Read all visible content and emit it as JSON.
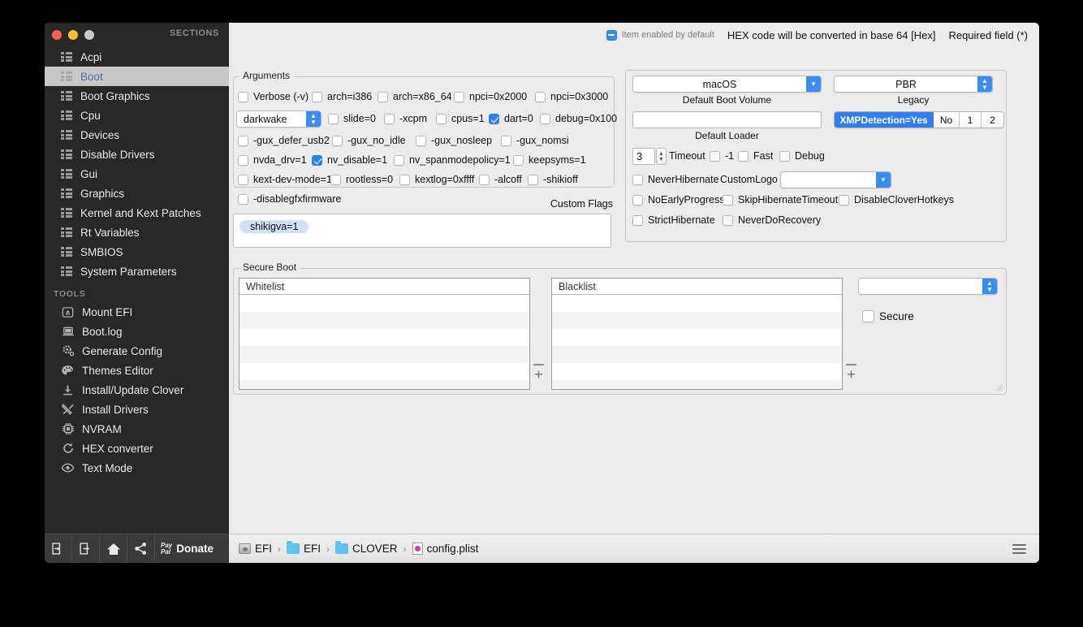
{
  "window": {
    "sections_header": "SECTIONS",
    "tools_header": "TOOLS"
  },
  "sidebar": {
    "sections": [
      {
        "label": "Acpi",
        "active": false
      },
      {
        "label": "Boot",
        "active": true
      },
      {
        "label": "Boot Graphics",
        "active": false
      },
      {
        "label": "Cpu",
        "active": false
      },
      {
        "label": "Devices",
        "active": false
      },
      {
        "label": "Disable Drivers",
        "active": false
      },
      {
        "label": "Gui",
        "active": false
      },
      {
        "label": "Graphics",
        "active": false
      },
      {
        "label": "Kernel and Kext Patches",
        "active": false
      },
      {
        "label": "Rt Variables",
        "active": false
      },
      {
        "label": "SMBIOS",
        "active": false
      },
      {
        "label": "System Parameters",
        "active": false
      }
    ],
    "tools": [
      {
        "label": "Mount EFI",
        "icon": "disk-eject-icon"
      },
      {
        "label": "Boot.log",
        "icon": "laptop-icon"
      },
      {
        "label": "Generate Config",
        "icon": "gear-icon"
      },
      {
        "label": "Themes Editor",
        "icon": "palette-icon"
      },
      {
        "label": "Install/Update Clover",
        "icon": "download-icon"
      },
      {
        "label": "Install Drivers",
        "icon": "tools-icon"
      },
      {
        "label": "NVRAM",
        "icon": "chip-icon"
      },
      {
        "label": "HEX converter",
        "icon": "refresh-icon"
      },
      {
        "label": "Text Mode",
        "icon": "eye-icon"
      }
    ],
    "toolbar": {
      "import_label": "import-icon",
      "export_label": "export-icon",
      "home_label": "home-icon",
      "share_label": "share-icon",
      "paypal_line1": "Pay",
      "paypal_line2": "Pal",
      "donate_label": "Donate"
    }
  },
  "legend": {
    "enabled_by_default": "Item enabled by default",
    "hex_note": "HEX code will be converted in base 64 [Hex]",
    "required_note": "Required field (*)"
  },
  "arguments": {
    "title": "Arguments",
    "row1": [
      {
        "label": "Verbose (-v)",
        "checked": false
      },
      {
        "label": "arch=i386",
        "checked": false
      },
      {
        "label": "arch=x86_64",
        "checked": false
      },
      {
        "label": "npci=0x2000",
        "checked": false
      },
      {
        "label": "npci=0x3000",
        "checked": false
      }
    ],
    "darkwake_value": "darkwake",
    "row2": [
      {
        "label": "slide=0",
        "checked": false
      },
      {
        "label": "-xcpm",
        "checked": false
      },
      {
        "label": "cpus=1",
        "checked": false
      },
      {
        "label": "dart=0",
        "checked": true
      },
      {
        "label": "debug=0x100",
        "checked": false
      }
    ],
    "row3": [
      {
        "label": "-gux_defer_usb2",
        "checked": false
      },
      {
        "label": "-gux_no_idle",
        "checked": false
      },
      {
        "label": "-gux_nosleep",
        "checked": false
      },
      {
        "label": "-gux_nomsi",
        "checked": false
      }
    ],
    "row4": [
      {
        "label": "nvda_drv=1",
        "checked": false
      },
      {
        "label": "nv_disable=1",
        "checked": true
      },
      {
        "label": "nv_spanmodepolicy=1",
        "checked": false
      },
      {
        "label": "keepsyms=1",
        "checked": false
      }
    ],
    "row5": [
      {
        "label": "kext-dev-mode=1",
        "checked": false
      },
      {
        "label": "rootless=0",
        "checked": false
      },
      {
        "label": "kextlog=0xffff",
        "checked": false
      },
      {
        "label": "-alcoff",
        "checked": false
      },
      {
        "label": "-shikioff",
        "checked": false
      }
    ],
    "row6": [
      {
        "label": "-disablegfxfirmware",
        "checked": false
      }
    ],
    "custom_flags_label": "Custom Flags",
    "custom_flags_tokens": [
      "shikigva=1"
    ]
  },
  "boot_options": {
    "default_boot_volume_value": "macOS",
    "default_boot_volume_label": "Default Boot Volume",
    "legacy_value": "PBR",
    "legacy_label": "Legacy",
    "default_loader_value": "",
    "default_loader_placeholder": "",
    "default_loader_label": "Default Loader",
    "xmp_segments": [
      {
        "label": "XMPDetection=Yes",
        "selected": true
      },
      {
        "label": "No",
        "selected": false
      },
      {
        "label": "1",
        "selected": false
      },
      {
        "label": "2",
        "selected": false
      }
    ],
    "timeout_value": "3",
    "timeout_label": "Timeout",
    "timeout_flags": [
      {
        "label": "-1",
        "checked": false
      },
      {
        "label": "Fast",
        "checked": false
      },
      {
        "label": "Debug",
        "checked": false
      }
    ],
    "never_hibernate": {
      "label": "NeverHibernate",
      "checked": false
    },
    "custom_logo_label": "CustomLogo",
    "custom_logo_value": "",
    "row_b": [
      {
        "label": "NoEarlyProgress",
        "checked": false
      },
      {
        "label": "SkipHibernateTimeout",
        "checked": false
      },
      {
        "label": "DisableCloverHotkeys",
        "checked": false
      }
    ],
    "row_c": [
      {
        "label": "StrictHibernate",
        "checked": false
      },
      {
        "label": "NeverDoRecovery",
        "checked": false
      }
    ]
  },
  "secure_boot": {
    "title": "Secure Boot",
    "whitelist_header": "Whitelist",
    "whitelist_rows": [],
    "blacklist_header": "Blacklist",
    "blacklist_rows": [],
    "policy_value": "",
    "secure_label": "Secure",
    "secure_checked": false,
    "add_label": "+",
    "remove_label": "−"
  },
  "breadcrumb": [
    {
      "label": "EFI",
      "icon": "disk-icon"
    },
    {
      "label": "EFI",
      "icon": "folder-icon"
    },
    {
      "label": "CLOVER",
      "icon": "folder-icon"
    },
    {
      "label": "config.plist",
      "icon": "plist-file-icon"
    }
  ],
  "colors": {
    "accent": "#2f7ff0",
    "sidebar_bg": "#282828",
    "window_bg": "#ececec",
    "token_bg": "#cfe0f7"
  }
}
